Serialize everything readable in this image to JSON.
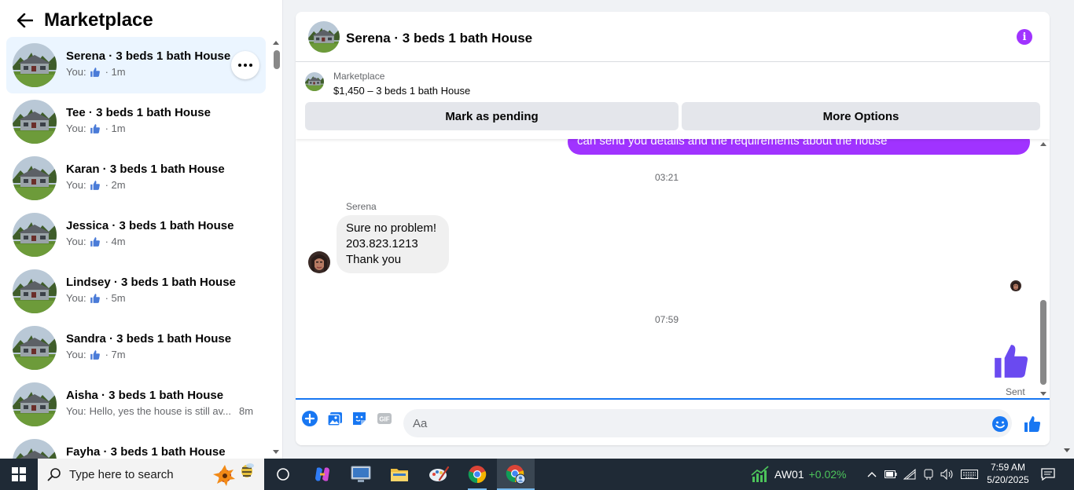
{
  "sidebar": {
    "title": "Marketplace",
    "conversations": [
      {
        "name": "Serena · 3 beds 1 bath House",
        "prefix": "You:",
        "has_like": true,
        "preview": "",
        "time": "· 1m",
        "active": true
      },
      {
        "name": "Tee · 3 beds 1 bath House",
        "prefix": "You:",
        "has_like": true,
        "preview": "",
        "time": "· 1m",
        "active": false
      },
      {
        "name": "Karan · 3 beds 1 bath House",
        "prefix": "You:",
        "has_like": true,
        "preview": "",
        "time": "· 2m",
        "active": false
      },
      {
        "name": "Jessica · 3 beds 1 bath House",
        "prefix": "You:",
        "has_like": true,
        "preview": "",
        "time": "· 4m",
        "active": false
      },
      {
        "name": "Lindsey · 3 beds 1 bath House",
        "prefix": "You:",
        "has_like": true,
        "preview": "",
        "time": "· 5m",
        "active": false
      },
      {
        "name": "Sandra · 3 beds 1 bath House",
        "prefix": "You:",
        "has_like": true,
        "preview": "",
        "time": "· 7m",
        "active": false
      },
      {
        "name": "Aisha · 3 beds 1 bath House",
        "prefix": "You:",
        "has_like": false,
        "preview": "Hello, yes the house is still av...",
        "time": "8m",
        "active": false
      },
      {
        "name": "Fayha · 3 beds 1 bath House",
        "prefix": "",
        "has_like": false,
        "preview": "",
        "time": "",
        "active": false
      }
    ]
  },
  "chat": {
    "title": "Serena · 3 beds 1 bath House",
    "listing": {
      "label": "Marketplace",
      "price": "$1,450 – 3 beds 1 bath House",
      "btn_pending": "Mark as pending",
      "btn_options": "More Options"
    },
    "messages": {
      "outgoing_partial": "can send you details and the requirements about the house",
      "timestamp1": "03:21",
      "sender": "Serena",
      "incoming_lines": [
        "Sure no problem!",
        "203.823.1213",
        "Thank you"
      ],
      "timestamp2": "07:59",
      "status": "Sent"
    },
    "composer": {
      "placeholder": "Aa"
    }
  },
  "colors": {
    "accent": "#a033ff",
    "brand_blue": "#1877f2",
    "active_row": "#ebf5ff"
  },
  "taskbar": {
    "search_placeholder": "Type here to search",
    "stock_symbol": "AW01",
    "stock_change": "+0.02%",
    "time": "7:59 AM",
    "date": "5/20/2025"
  }
}
